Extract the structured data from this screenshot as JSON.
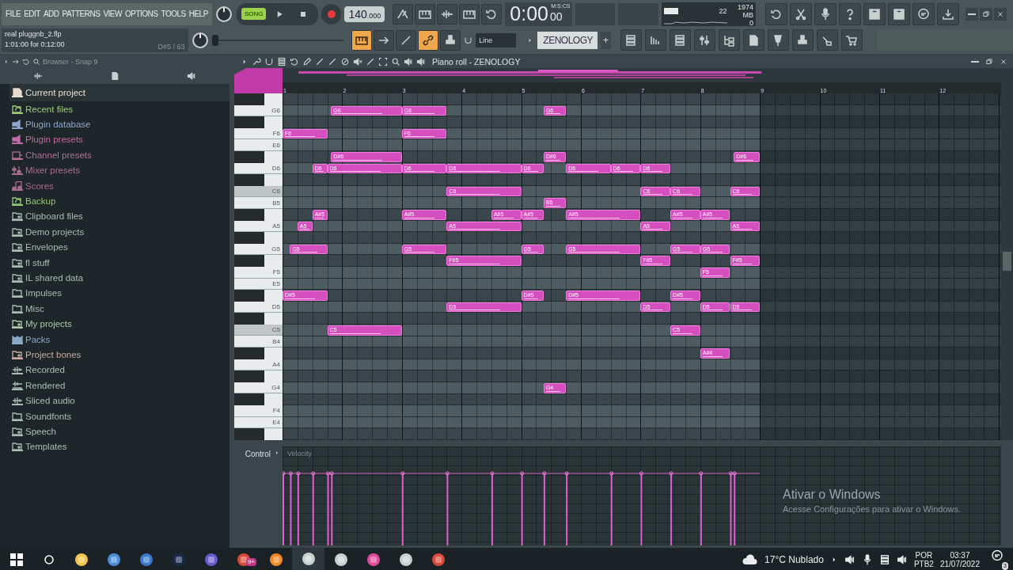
{
  "menu": [
    "FILE",
    "EDIT",
    "ADD",
    "PATTERNS",
    "VIEW",
    "OPTIONS",
    "TOOLS",
    "HELP"
  ],
  "transport": {
    "mode_label": "SONG",
    "song_selected": true
  },
  "tempo": "140",
  "tempo_decimals": ".000",
  "time": {
    "main": "0:00",
    "cs": "00",
    "unit": "M:S:CS"
  },
  "monitor": {
    "cpu": "22",
    "memory": "1974 MB",
    "polyphony": "0"
  },
  "project": {
    "file": "real pluggnb_2.flp",
    "length": "1:01:00 for 0:12:00",
    "hint": "D#5 / 63"
  },
  "master_slider": {
    "level": 0
  },
  "tools": [
    {
      "on": true
    },
    {
      "on": false
    },
    {
      "on": false
    },
    {
      "on": true
    },
    {
      "on": false
    }
  ],
  "snap": "Line",
  "channel": "ZENOLOGY",
  "add": "+",
  "browser": {
    "title": "Browser - Snap 9",
    "items": [
      {
        "label": "Current project",
        "kind": "project",
        "color": "#e8dcd0",
        "selected": true
      },
      {
        "label": "Recent files",
        "kind": "sync",
        "color": "#9ccc78",
        "selected": false
      },
      {
        "label": "Plugin database",
        "kind": "plugin",
        "color": "#8ea6cc",
        "selected": false
      },
      {
        "label": "Plugin presets",
        "kind": "plugin",
        "color": "#c06aa6",
        "selected": false
      },
      {
        "label": "Channel presets",
        "kind": "channel",
        "color": "#b07096",
        "selected": false
      },
      {
        "label": "Mixer presets",
        "kind": "mixer",
        "color": "#a87090",
        "selected": false
      },
      {
        "label": "Scores",
        "kind": "score",
        "color": "#a86a8c",
        "selected": false
      },
      {
        "label": "Backup",
        "kind": "sync",
        "color": "#94c876",
        "selected": false
      },
      {
        "label": "Clipboard files",
        "kind": "linked",
        "color": "#a8bcb4",
        "selected": false
      },
      {
        "label": "Demo projects",
        "kind": "linked",
        "color": "#a8bcb4",
        "selected": false
      },
      {
        "label": "Envelopes",
        "kind": "linked",
        "color": "#a8bcb4",
        "selected": false
      },
      {
        "label": "fl stuff",
        "kind": "linked",
        "color": "#a8bcb4",
        "selected": false
      },
      {
        "label": "IL shared data",
        "kind": "linked",
        "color": "#a8bcb4",
        "selected": false
      },
      {
        "label": "Impulses",
        "kind": "folder",
        "color": "#a8bcb4",
        "selected": false
      },
      {
        "label": "Misc",
        "kind": "folder",
        "color": "#a8bcb4",
        "selected": false
      },
      {
        "label": "My projects",
        "kind": "linked",
        "color": "#a8c8a8",
        "selected": false
      },
      {
        "label": "Packs",
        "kind": "packs",
        "color": "#8aa8c8",
        "selected": false
      },
      {
        "label": "Project bones",
        "kind": "linked",
        "color": "#c8aca4",
        "selected": false
      },
      {
        "label": "Recorded",
        "kind": "audio",
        "color": "#a8bcb4",
        "selected": false
      },
      {
        "label": "Rendered",
        "kind": "rendered",
        "color": "#a8bcb4",
        "selected": false
      },
      {
        "label": "Sliced audio",
        "kind": "audio",
        "color": "#a8bcb4",
        "selected": false
      },
      {
        "label": "Soundfonts",
        "kind": "folder",
        "color": "#a8bcb4",
        "selected": false
      },
      {
        "label": "Speech",
        "kind": "linked",
        "color": "#a8bcb4",
        "selected": false
      },
      {
        "label": "Templates",
        "kind": "linked",
        "color": "#a8bcb4",
        "selected": false
      }
    ]
  },
  "piano_roll": {
    "title": "Piano roll - ZENOLOGY",
    "ruler": [
      "1",
      "2",
      "3",
      "4",
      "5",
      "6",
      "7",
      "8",
      "9",
      "10",
      "11",
      "12"
    ],
    "rows": [
      {
        "kind": "black",
        "notes": []
      },
      {
        "kind": "white",
        "key": "G6",
        "notes": [
          "G6",
          "G6",
          "G6"
        ]
      },
      {
        "kind": "black",
        "notes": []
      },
      {
        "kind": "white",
        "key": "F6",
        "notes": [
          "F6",
          "F6"
        ]
      },
      {
        "kind": "white",
        "key": "E6",
        "notes": []
      },
      {
        "kind": "black",
        "notes": [
          "D#6",
          "D#6",
          "D#6"
        ]
      },
      {
        "kind": "white",
        "key": "D6",
        "notes": [
          "D6",
          "D6",
          "D6",
          "D6",
          "D6",
          "D6",
          "D6",
          "D6"
        ]
      },
      {
        "kind": "black",
        "notes": []
      },
      {
        "kind": "c",
        "key": "C6",
        "notes": [
          "C6",
          "C6",
          "C6",
          "C6"
        ]
      },
      {
        "kind": "white",
        "key": "B5",
        "notes": [
          "B5"
        ]
      },
      {
        "kind": "black",
        "notes": [
          "A#5",
          "A#5",
          "A#5",
          "A#5",
          "A#5",
          "A#5",
          "A#5"
        ]
      },
      {
        "kind": "white",
        "key": "A5",
        "notes": [
          "A5",
          "A5",
          "A5",
          "A5"
        ]
      },
      {
        "kind": "black",
        "notes": []
      },
      {
        "kind": "white",
        "key": "G5",
        "notes": [
          "G5",
          "G5",
          "G5",
          "G5",
          "G5",
          "G5"
        ]
      },
      {
        "kind": "black",
        "notes": [
          "F#5",
          "F#5",
          "F#5"
        ]
      },
      {
        "kind": "white",
        "key": "F5",
        "notes": [
          "F5"
        ]
      },
      {
        "kind": "white",
        "key": "E5",
        "notes": []
      },
      {
        "kind": "black",
        "notes": [
          "D#5",
          "D#5",
          "D#5",
          "D#5"
        ]
      },
      {
        "kind": "white",
        "key": "D5",
        "notes": [
          "D5",
          "D5",
          "D5",
          "D5"
        ]
      },
      {
        "kind": "black",
        "notes": []
      },
      {
        "kind": "c",
        "key": "C5",
        "notes": [
          "C5",
          "C5"
        ]
      },
      {
        "kind": "white",
        "key": "B4",
        "notes": []
      },
      {
        "kind": "black",
        "notes": [
          "A#4"
        ]
      },
      {
        "kind": "white",
        "key": "A4",
        "notes": []
      },
      {
        "kind": "black",
        "notes": []
      },
      {
        "kind": "white",
        "key": "G4",
        "notes": [
          "G4"
        ]
      },
      {
        "kind": "black",
        "notes": []
      },
      {
        "kind": "white",
        "key": "F4",
        "notes": []
      },
      {
        "kind": "white",
        "key": "E4",
        "notes": []
      },
      {
        "kind": "black",
        "notes": []
      }
    ],
    "control": "Control",
    "control_target": "Velocity"
  },
  "windows_notice": {
    "title": "Ativar o Windows",
    "text": "Acesse Configurações para ativar o Windows."
  },
  "taskbar": {
    "apps": [
      {
        "active": false
      },
      {
        "active": false
      },
      {
        "active": false
      },
      {
        "active": false
      },
      {
        "active": false
      },
      {
        "active": false
      },
      {
        "active": false
      },
      {
        "active": false
      },
      {
        "active": true
      },
      {
        "active": false
      },
      {
        "active": false
      },
      {
        "active": false
      },
      {
        "active": false
      }
    ],
    "app_badge": "9+",
    "weather": "17°C Nublado",
    "lang": "POR",
    "layout": "PTB2",
    "time": "03:37",
    "date": "21/07/2022",
    "notifications": "3"
  }
}
